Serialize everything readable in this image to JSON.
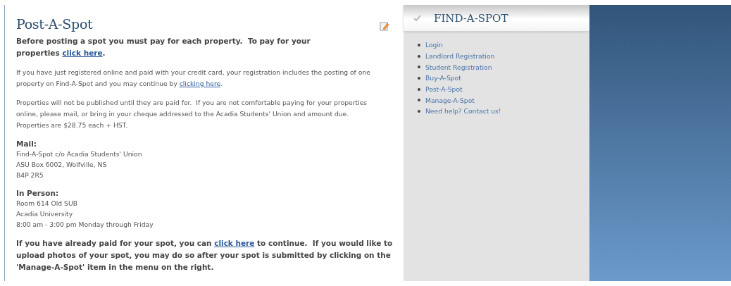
{
  "main": {
    "title": "Post-A-Spot",
    "paragraphs": [
      {
        "kind": "bold",
        "parts": [
          {
            "kind": "text",
            "text": "Before posting a spot you must pay for each property.  To pay for your properties "
          },
          {
            "kind": "link",
            "text": "click here"
          },
          {
            "kind": "text",
            "text": "."
          }
        ]
      },
      {
        "kind": "plain",
        "parts": [
          {
            "kind": "text",
            "text": "If you have just registered online and paid with your credit card, your registration includes the posting of one property on Find-A-Spot and you may continue by "
          },
          {
            "kind": "link",
            "text": "clicking here"
          },
          {
            "kind": "text",
            "text": "."
          }
        ]
      },
      {
        "kind": "plain",
        "parts": [
          {
            "kind": "text",
            "text": "Properties will not be published until they are paid for.  If you are not comfortable paying for your properties online, please mail, or bring in your cheque addressed to the Acadia Students' Union and amount due.  Properties are $28.75 each + HST."
          }
        ]
      },
      {
        "kind": "address",
        "heading": "Mail:",
        "lines": [
          "Find-A-Spot c/o Acadia Students' Union",
          "ASU Box 6002, Wolfville, NS",
          "B4P 2R5"
        ]
      },
      {
        "kind": "address",
        "heading": "In Person:",
        "lines": [
          "Room 614 Old SUB",
          "Acadia University",
          "8:00 am - 3:00 pm Monday through Friday"
        ]
      },
      {
        "kind": "bold",
        "parts": [
          {
            "kind": "text",
            "text": "If you have already paid for your spot, you can "
          },
          {
            "kind": "link",
            "text": "click here"
          },
          {
            "kind": "text",
            "text": " to continue.  If you would like to upload photos of your spot, you may do so after your spot is submitted by clicking on the 'Manage-A-Spot' item in the menu on the right."
          }
        ]
      }
    ]
  },
  "sidebar": {
    "title": "FIND-A-SPOT",
    "items": [
      "Login",
      "Landlord Registration",
      "Student Registration",
      "Buy-A-Spot",
      "Post-A-Spot",
      "Manage-A-Spot",
      "Need help? Contact us!"
    ]
  }
}
